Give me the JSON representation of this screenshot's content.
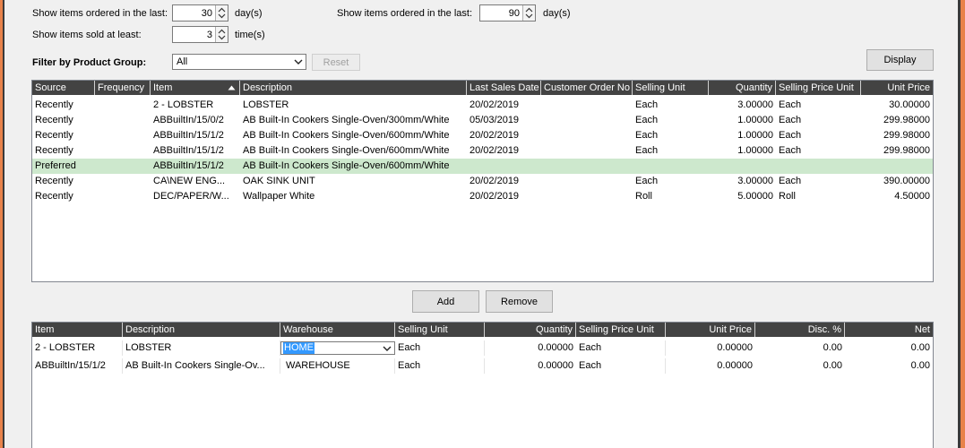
{
  "filters": {
    "ordered_last_left_label": "Show items ordered in the last:",
    "ordered_last_left_value": "30",
    "days_unit_left": "day(s)",
    "ordered_last_right_label": "Show items ordered in the last:",
    "ordered_last_right_value": "90",
    "days_unit_right": "day(s)",
    "sold_least_label": "Show items sold at least:",
    "sold_least_value": "3",
    "times_unit": "time(s)",
    "group_label": "Filter by Product Group:",
    "group_value": "All",
    "reset_label": "Reset",
    "display_label": "Display"
  },
  "top_grid": {
    "columns": [
      "Source",
      "Frequency",
      "Item",
      "Description",
      "Last Sales Date",
      "Customer Order No",
      "Selling Unit",
      "Quantity",
      "Selling Price Unit",
      "Unit Price"
    ],
    "rows": [
      {
        "source": "Recently",
        "frequency": "",
        "item": "2 - LOBSTER",
        "description": "LOBSTER",
        "date": "20/02/2019",
        "order_no": "",
        "unit": "Each",
        "qty": "3.00000",
        "price_unit": "Each",
        "price": "30.00000"
      },
      {
        "source": "Recently",
        "frequency": "",
        "item": "ABBuiltIn/15/0/2",
        "description": "AB Built-In Cookers Single-Oven/300mm/White",
        "date": "05/03/2019",
        "order_no": "",
        "unit": "Each",
        "qty": "1.00000",
        "price_unit": "Each",
        "price": "299.98000"
      },
      {
        "source": "Recently",
        "frequency": "",
        "item": "ABBuiltIn/15/1/2",
        "description": "AB Built-In Cookers Single-Oven/600mm/White",
        "date": "20/02/2019",
        "order_no": "",
        "unit": "Each",
        "qty": "1.00000",
        "price_unit": "Each",
        "price": "299.98000"
      },
      {
        "source": "Recently",
        "frequency": "",
        "item": "ABBuiltIn/15/1/2",
        "description": "AB Built-In Cookers Single-Oven/600mm/White",
        "date": "20/02/2019",
        "order_no": "",
        "unit": "Each",
        "qty": "1.00000",
        "price_unit": "Each",
        "price": "299.98000"
      },
      {
        "source": "Preferred",
        "frequency": "",
        "item": "ABBuiltIn/15/1/2",
        "description": "AB Built-In Cookers Single-Oven/600mm/White",
        "date": "",
        "order_no": "",
        "unit": "",
        "qty": "",
        "price_unit": "",
        "price": ""
      },
      {
        "source": "Recently",
        "frequency": "",
        "item": "CA\\NEW ENG...",
        "description": "OAK SINK UNIT",
        "date": "20/02/2019",
        "order_no": "",
        "unit": "Each",
        "qty": "3.00000",
        "price_unit": "Each",
        "price": "390.00000"
      },
      {
        "source": "Recently",
        "frequency": "",
        "item": "DEC/PAPER/W...",
        "description": "Wallpaper White",
        "date": "20/02/2019",
        "order_no": "",
        "unit": "Roll",
        "qty": "5.00000",
        "price_unit": "Roll",
        "price": "4.50000"
      }
    ]
  },
  "actions": {
    "add_label": "Add",
    "remove_label": "Remove"
  },
  "bottom_grid": {
    "columns": [
      "Item",
      "Description",
      "Warehouse",
      "Selling Unit",
      "Quantity",
      "Selling Price Unit",
      "Unit Price",
      "Disc. %",
      "Net"
    ],
    "rows": [
      {
        "item": "2 - LOBSTER",
        "description": "LOBSTER",
        "warehouse": "HOME",
        "unit": "Each",
        "qty": "0.00000",
        "price_unit": "Each",
        "price": "0.00000",
        "disc": "0.00",
        "net": "0.00"
      },
      {
        "item": "ABBuiltIn/15/1/2",
        "description": "AB Built-In Cookers Single-Ov...",
        "warehouse": "WAREHOUSE",
        "unit": "Each",
        "qty": "0.00000",
        "price_unit": "Each",
        "price": "0.00000",
        "disc": "0.00",
        "net": "0.00"
      }
    ]
  },
  "colors": {
    "frame": "#e8824a",
    "grid_header": "#434343",
    "selected_row": "#cde8cd",
    "edit_highlight": "#3399ff"
  }
}
